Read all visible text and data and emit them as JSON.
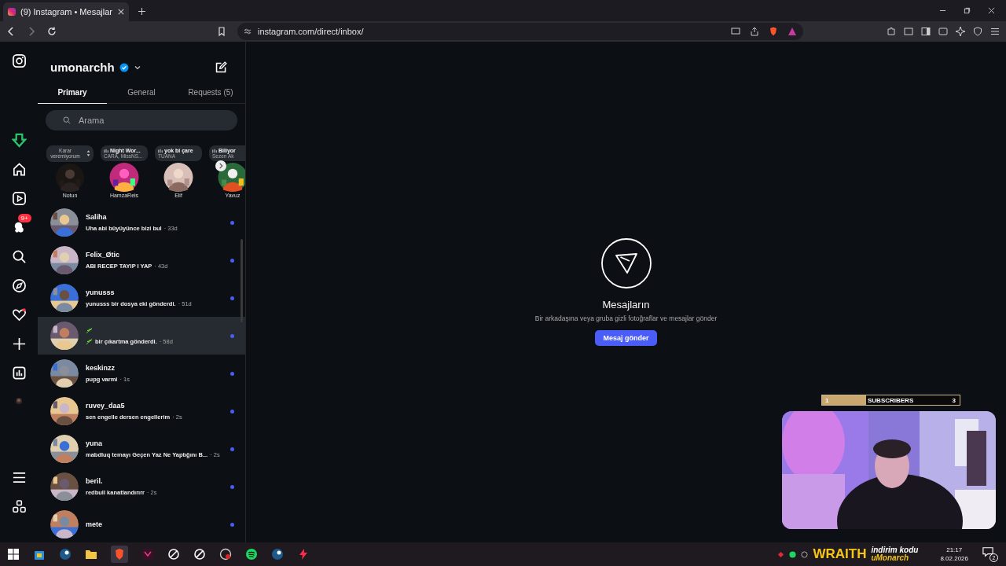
{
  "browser": {
    "tab_title": "(9) Instagram • Mesajlar",
    "url": "instagram.com/direct/inbox/"
  },
  "nav": {
    "messages_badge": "9+"
  },
  "inbox": {
    "username": "umonarchh",
    "verified": true,
    "tabs": [
      {
        "label": "Primary",
        "selected": true
      },
      {
        "label": "General",
        "selected": false
      },
      {
        "label": "Requests (5)",
        "selected": false
      }
    ],
    "search": {
      "placeholder": "Arama"
    },
    "notes": [
      {
        "kind": "text",
        "note": "Karar veremiyorum",
        "name": "Notun"
      },
      {
        "kind": "music",
        "title": "Night Wor...",
        "artist": "CARA, MissNS...",
        "name": "HamzaReis"
      },
      {
        "kind": "music",
        "title": "yok bi çare",
        "artist": "TUANA",
        "name": "Elif"
      },
      {
        "kind": "music",
        "title": "Biliyor",
        "artist": "Sezen Ak",
        "name": "Yavuz"
      }
    ],
    "threads": [
      {
        "name": "Saliha",
        "preview": "Uha abi büyüyünce bizi bul",
        "time": "· 33d",
        "unread": true,
        "selected": false
      },
      {
        "name": "Felix_Øtic",
        "preview": "ABI RECEP TAYIP I YAP",
        "time": "· 43d",
        "unread": true,
        "selected": false
      },
      {
        "name": "yunusss",
        "preview": "yunusss bir dosya eki gönderdi.",
        "time": "· 51d",
        "unread": true,
        "selected": false
      },
      {
        "name_emoji": true,
        "preview": "bir çıkartma gönderdi.",
        "time": "· 58d",
        "unread": true,
        "selected": true
      },
      {
        "name": "keskinzz",
        "preview": "pupg varmi",
        "time": "· 1s",
        "unread": true,
        "selected": false
      },
      {
        "name": "ruvey_daa5",
        "preview": "sen engelle dersen engellerim",
        "time": "· 2s",
        "unread": true,
        "selected": false
      },
      {
        "name": "yuna",
        "preview": "mabdluq temayı Geçen Yaz Ne Yaptığını B...",
        "time": "· 2s",
        "unread": true,
        "selected": false
      },
      {
        "name": "beril.",
        "preview": "redbull kanatlandırırr",
        "time": "· 2s",
        "unread": true,
        "selected": false
      },
      {
        "name": "mete",
        "unread": true,
        "selected": false
      }
    ]
  },
  "empty_state": {
    "title": "Mesajların",
    "text": "Bir arkadaşına veya gruba gizli fotoğraflar ve mesajlar gönder",
    "button": "Mesaj gönder"
  },
  "overlay": {
    "subscribers": {
      "start": "1",
      "label": "SUBSCRIBERS",
      "goal": "3",
      "level": 0.32
    },
    "promo": {
      "brand": "WRAITH",
      "text": "indirim kodu",
      "code": "uMonarch"
    }
  },
  "taskbar": {
    "time": "21:17",
    "date": "8.02.2026",
    "notifications": "2"
  }
}
